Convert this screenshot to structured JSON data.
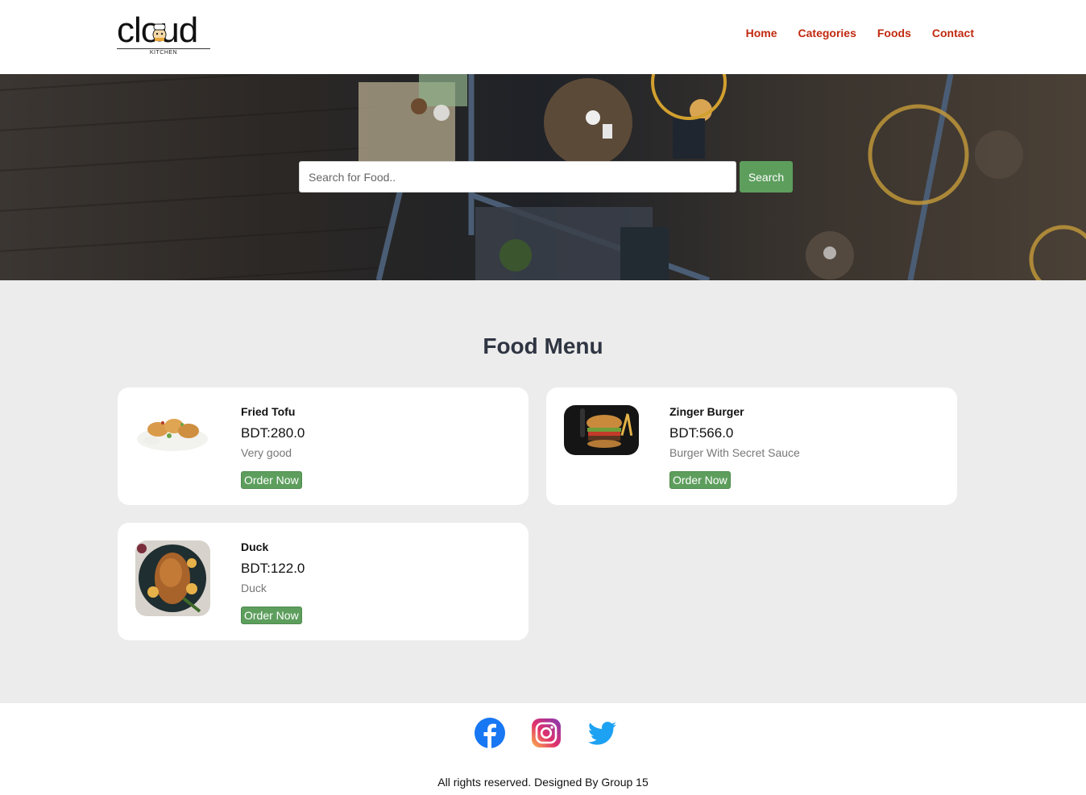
{
  "header": {
    "logo_text": "cloud",
    "logo_sub": "KITCHEN",
    "nav": [
      "Home",
      "Categories",
      "Foods",
      "Contact"
    ]
  },
  "search": {
    "placeholder": "Search for Food..",
    "button_label": "Search"
  },
  "menu": {
    "title": "Food Menu",
    "items": [
      {
        "name": "Fried Tofu",
        "price": "BDT:280.0",
        "description": "Very good",
        "order_label": "Order Now",
        "image": "fried-tofu-image"
      },
      {
        "name": "Zinger Burger",
        "price": "BDT:566.0",
        "description": "Burger With Secret Sauce",
        "order_label": "Order Now",
        "image": "zinger-burger-image"
      },
      {
        "name": "Duck",
        "price": "BDT:122.0",
        "description": "Duck",
        "order_label": "Order Now",
        "image": "duck-image"
      }
    ]
  },
  "footer": {
    "social": [
      "facebook-icon",
      "instagram-icon",
      "twitter-icon"
    ],
    "copyright": "All rights reserved. Designed By Group 15"
  },
  "colors": {
    "nav_link": "#c1290f",
    "button": "#5d9e5d",
    "page_bg": "#ececec",
    "title": "#2f3542"
  }
}
